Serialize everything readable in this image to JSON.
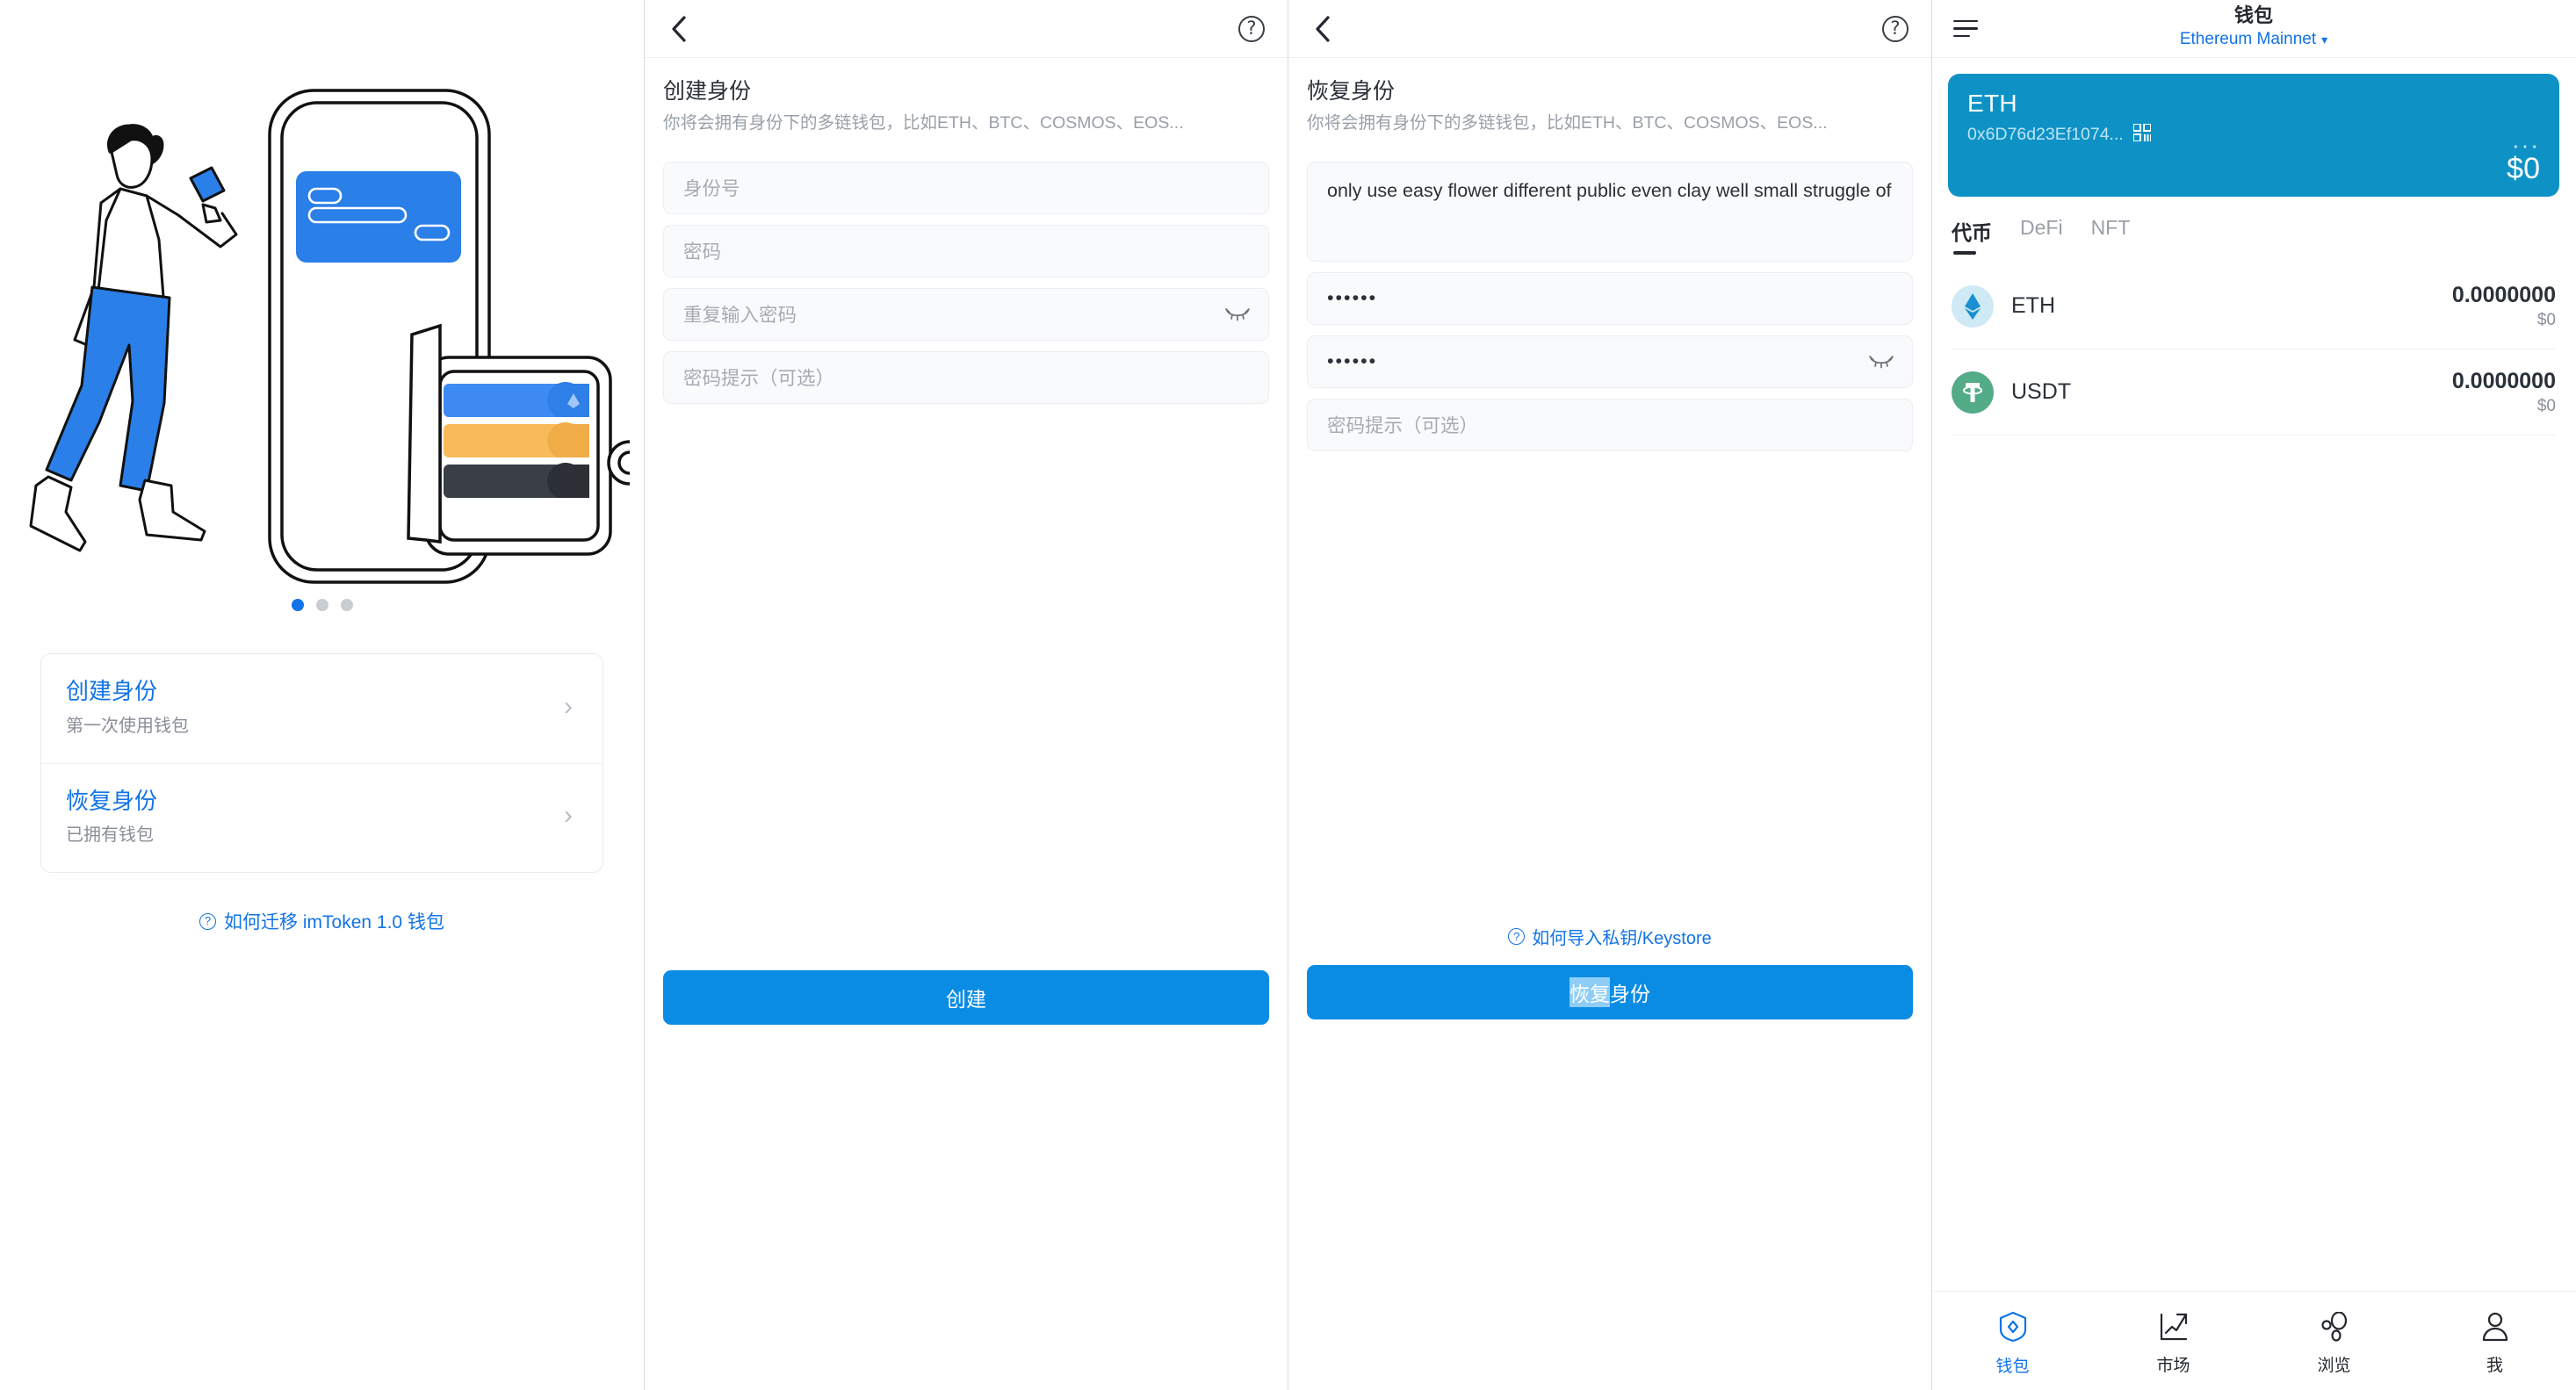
{
  "onboarding": {
    "carousel": {
      "dot_count": 3,
      "active_index": 0
    },
    "options": [
      {
        "title": "创建身份",
        "subtitle": "第一次使用钱包",
        "chevron": "chevron-right-icon"
      },
      {
        "title": "恢复身份",
        "subtitle": "已拥有钱包",
        "chevron": "chevron-right-icon"
      }
    ],
    "migrate_link": "如何迁移 imToken 1.0 钱包",
    "help_glyph": "?"
  },
  "create_identity": {
    "back_icon": "chevron-left-icon",
    "help_icon": "question-circle-icon",
    "title": "创建身份",
    "description": "你将会拥有身份下的多链钱包，比如ETH、BTC、COSMOS、EOS...",
    "fields": [
      {
        "name": "identity-id",
        "placeholder": "身份号",
        "value": ""
      },
      {
        "name": "password",
        "placeholder": "密码",
        "value": ""
      },
      {
        "name": "password-repeat",
        "placeholder": "重复输入密码",
        "value": "",
        "eye": true
      },
      {
        "name": "password-hint",
        "placeholder": "密码提示（可选）",
        "value": ""
      }
    ],
    "submit_label": "创建"
  },
  "recover_identity": {
    "back_icon": "chevron-left-icon",
    "help_icon": "question-circle-icon",
    "title": "恢复身份",
    "description": "你将会拥有身份下的多链钱包，比如ETH、BTC、COSMOS、EOS...",
    "mnemonic_value": "only use easy flower different public even clay well small struggle of",
    "password_value": "••••••",
    "password_repeat_value": "••••••",
    "hint_placeholder": "密码提示（可选）",
    "keystore_link": "如何导入私钥/Keystore",
    "submit_label_selected": "恢复",
    "submit_label_rest": "身份"
  },
  "wallet": {
    "menu_icon": "hamburger-icon",
    "title": "钱包",
    "network": "Ethereum Mainnet",
    "network_caret": "chevron-down-icon",
    "account": {
      "symbol": "ETH",
      "address": "0x6D76d23Ef1074...",
      "qr_icon": "qr-code-icon",
      "more_icon": "more-horizontal-icon",
      "balance": "$0"
    },
    "tabs": [
      {
        "label": "代币",
        "active": true
      },
      {
        "label": "DeFi",
        "active": false
      },
      {
        "label": "NFT",
        "active": false
      }
    ],
    "tokens": [
      {
        "symbol": "ETH",
        "amount": "0.0000000",
        "usd": "$0",
        "icon": "eth-token-icon",
        "color": "#cfe9f5"
      },
      {
        "symbol": "USDT",
        "amount": "0.0000000",
        "usd": "$0",
        "icon": "usdt-token-icon",
        "color": "#53ab87"
      }
    ],
    "bottom_nav": [
      {
        "label": "钱包",
        "icon": "wallet-icon",
        "active": true
      },
      {
        "label": "市场",
        "icon": "market-chart-icon",
        "active": false
      },
      {
        "label": "浏览",
        "icon": "browse-icon",
        "active": false
      },
      {
        "label": "我",
        "icon": "profile-icon",
        "active": false
      }
    ]
  },
  "colors": {
    "brand_blue": "#1273e6",
    "button_blue": "#0b8ce4",
    "card_teal": "#0e92c6",
    "muted": "#9aa0a8",
    "selection": "#8ecdf5"
  }
}
